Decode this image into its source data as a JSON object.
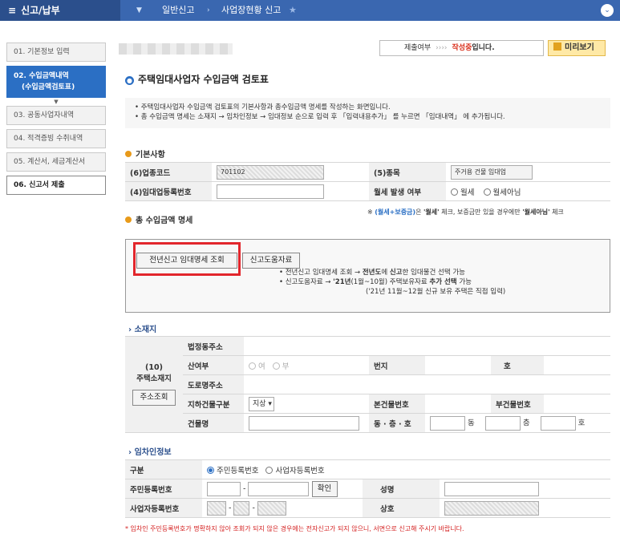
{
  "topbar": {
    "menu": "신고/납부",
    "crumb1": "일반신고",
    "crumb2": "사업장현황 신고",
    "star": "★",
    "chevron": "⌄"
  },
  "sidebar": {
    "items": [
      {
        "label": "01. 기본정보 입력"
      },
      {
        "label1": "02. 수입금액내역",
        "label2": "(수입금액검토표)"
      },
      {
        "label": "03. 공동사업자내역"
      },
      {
        "label": "04. 적격증빙 수취내역"
      },
      {
        "label": "05. 계산서, 세금계산서"
      },
      {
        "label": "06. 신고서 제출"
      }
    ]
  },
  "status": {
    "label": "제출여부",
    "arrows": "››››",
    "state": "작성중",
    "suffix": "입니다.",
    "preview": "미리보기"
  },
  "page": {
    "title": "주택임대사업자 수입금액 검토표",
    "desc1": "• 주택임대사업자 수입금액 검토표의 기본사항과 총수입금액 명세를 작성하는 화면입니다.",
    "desc2": "• 총 수입금액 명세는 소재지 → 임차인정보 → 임대정보 순으로 입력 후 「입력내용추가」 를 누르면 「임대내역」 에 추가됩니다."
  },
  "basic": {
    "title": "기본사항",
    "biz_code_label": "(6)업종코드",
    "biz_code": "701102",
    "type_label": "(5)종목",
    "type_value": "주거용 건물 임대업",
    "reg_label": "(4)임대업등록번호",
    "monthly_label": "월세 발생 여부",
    "opt1": "월세",
    "opt2": "월세아님"
  },
  "note": {
    "a": "※ ",
    "b1": "(월세+보증금)",
    "c": "은 ",
    "b2": "'월세'",
    "d": " 체크, 보증금만 있을 경우에만 ",
    "b3": "'월세아님'",
    "e": " 체크"
  },
  "income": {
    "title": "총 수입금액 명세",
    "btn_prev": "전년신고 임대명세 조회",
    "btn_help": "신고도움자료",
    "g1a": "• 전년신고 임대명세 조회 → ",
    "g1b": "전년도",
    "g1c": "에 ",
    "g1d": "신고",
    "g1e": "한 임대물건 선택 가능",
    "g2a": "• 신고도움자료 → ",
    "g2b": "'21년",
    "g2c": "(1월~10월) 주택보유자료 ",
    "g2d": "추가 선택",
    "g2e": " 가능",
    "g3": "('21년 11월~12월 신규 보유 주택은 직접 입력)"
  },
  "location": {
    "title": "소재지",
    "head1": "(10)",
    "head2": "주택소재지",
    "addr_btn": "주소조회",
    "legal": "법정동주소",
    "mountain": "산여부",
    "yes": "여",
    "no": "부",
    "lot": "번지",
    "ho": "호",
    "road": "도로명주소",
    "underground": "지하건물구분",
    "ug_value": "지상",
    "main_no": "본건물번호",
    "sub_no": "부건물번호",
    "bldg": "건물명",
    "dong": "동 · 층 · 호",
    "d1": "동",
    "d2": "층",
    "d3": "호"
  },
  "tenant": {
    "title": "임차인정보",
    "kind": "구분",
    "k1": "주민등록번호",
    "k2": "사업자등록번호",
    "rrn": "주민등록번호",
    "confirm": "확인",
    "name": "성명",
    "brn": "사업자등록번호",
    "company": "상호"
  },
  "warning": "* 임차인 주민등록번호가 명확하지 않아 조회가 되지 않은 경우에는 전자신고가 되지 않으니, 서면으로 신고해 주시기 바랍니다."
}
